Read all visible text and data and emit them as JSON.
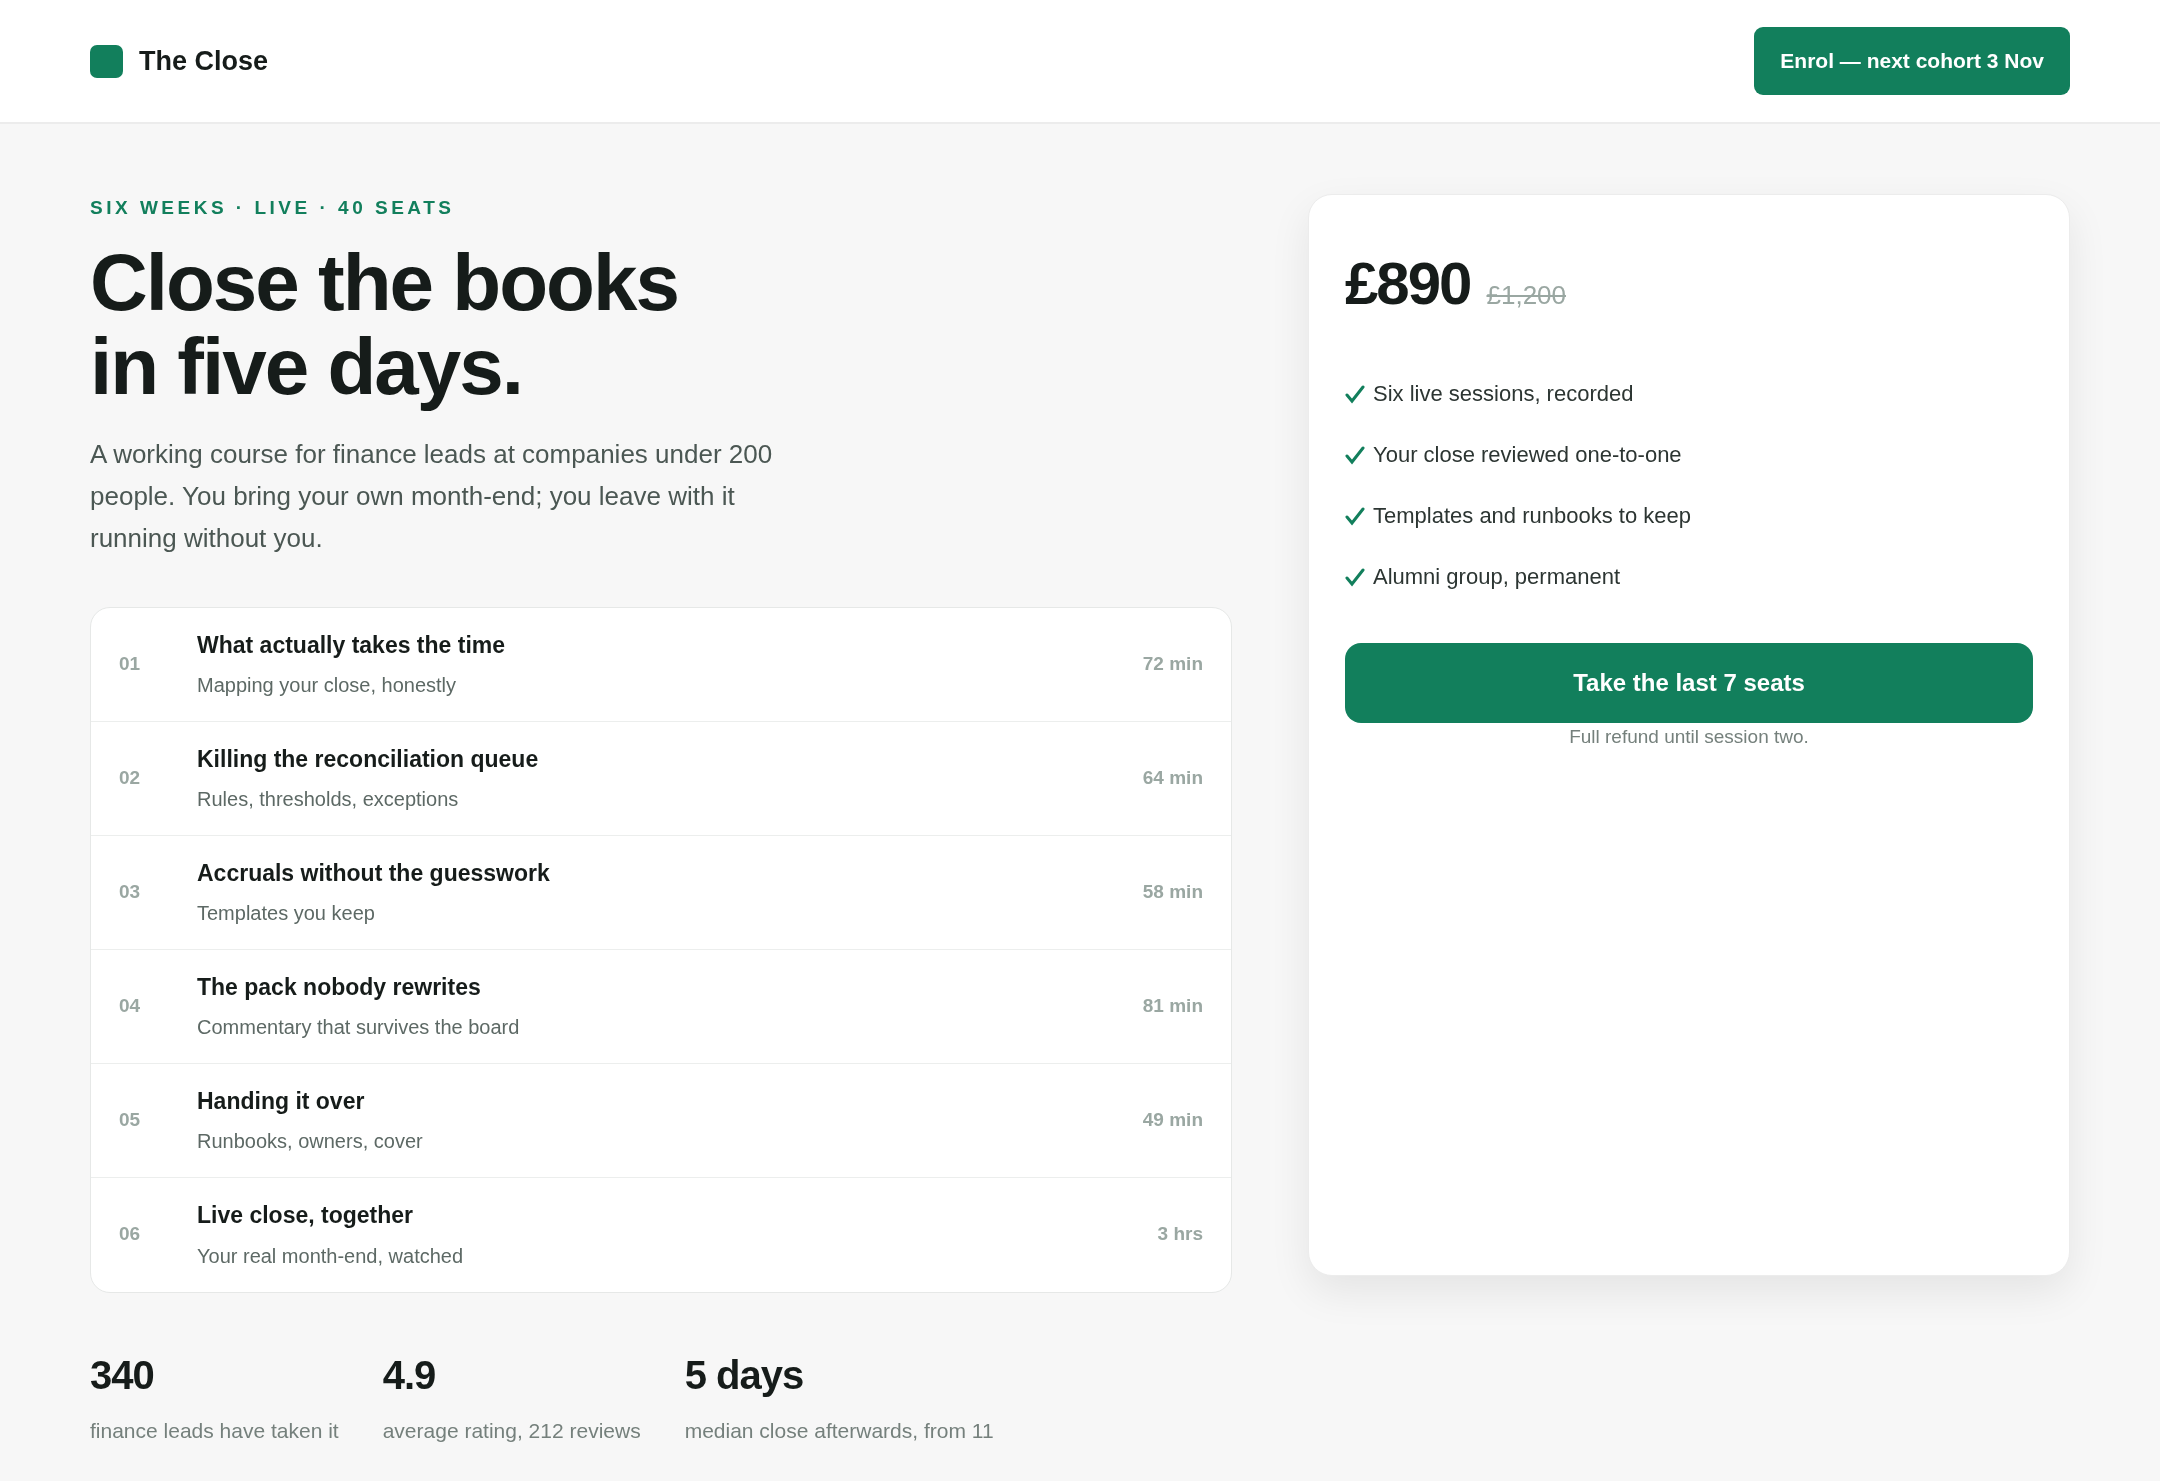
{
  "header": {
    "brand": "The Close",
    "cta": "Enrol — next cohort 3 Nov"
  },
  "hero": {
    "eyebrow": "SIX WEEKS · LIVE · 40 SEATS",
    "title_lines": [
      "Close the books",
      "in five days."
    ],
    "intro": "A working course for finance leads at companies under 200 people. You bring your own month-end; you leave with it running without you."
  },
  "sessions": [
    {
      "number": "01",
      "title": "What actually takes the time",
      "subtitle": "Mapping your close, honestly",
      "duration": "72 min"
    },
    {
      "number": "02",
      "title": "Killing the reconciliation queue",
      "subtitle": "Rules, thresholds, exceptions",
      "duration": "64 min"
    },
    {
      "number": "03",
      "title": "Accruals without the guesswork",
      "subtitle": "Templates you keep",
      "duration": "58 min"
    },
    {
      "number": "04",
      "title": "The pack nobody rewrites",
      "subtitle": "Commentary that survives the board",
      "duration": "81 min"
    },
    {
      "number": "05",
      "title": "Handing it over",
      "subtitle": "Runbooks, owners, cover",
      "duration": "49 min"
    },
    {
      "number": "06",
      "title": "Live close, together",
      "subtitle": "Your real month-end, watched",
      "duration": "3 hrs"
    }
  ],
  "stats": [
    {
      "value": "340",
      "label": "finance leads have taken it"
    },
    {
      "value": "4.9",
      "label": "average rating, 212 reviews"
    },
    {
      "value": "5 days",
      "label": "median close afterwards, from 11"
    }
  ],
  "pricing": {
    "price": "£890",
    "old_price": "£1,200",
    "features": [
      "Six live sessions, recorded",
      "Your close reviewed one-to-one",
      "Templates and runbooks to keep",
      "Alumni group, permanent"
    ],
    "button": "Take the last 7 seats",
    "note": "Full refund until session two."
  }
}
